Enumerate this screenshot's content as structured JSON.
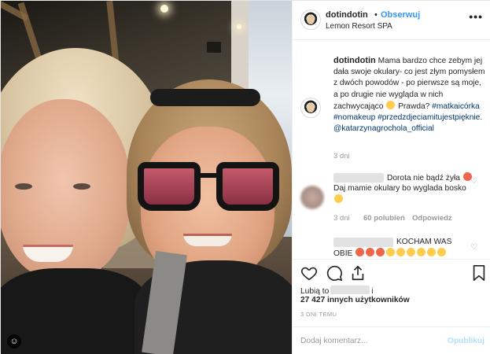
{
  "header": {
    "username": "dotindotin",
    "separator": "•",
    "follow_label": "Obserwuj",
    "location": "Lemon Resort SPA",
    "more_label": "•••"
  },
  "caption": {
    "username": "dotindotin",
    "text_1": "Mama bardzo chce zebym jej dała swoje okulary- co jest złym pomysłem z dwóch powodów - po pierwsze są moje, a po drugie nie wygląda w nich zachwycająco",
    "text_2": "Prawda?",
    "tags": [
      "#matkaicórka",
      "#nomakeup",
      "#przedzdjeciamitujestpięknie.",
      "@katarzynagrochola_official"
    ],
    "age": "3 dni"
  },
  "comments": [
    {
      "text_1": "Dorota nie bądź żyła",
      "text_2": "Daj mamie okulary bo wyglada bosko",
      "age": "3 dni",
      "likes": "60 polubień",
      "reply_label": "Odpowiedz"
    },
    {
      "text_1": "KOCHAM WAS",
      "text_2": "OBIE"
    }
  ],
  "actions": {
    "like_icon": "heart-icon",
    "comment_icon": "comment-icon",
    "share_icon": "share-icon",
    "save_icon": "bookmark-icon"
  },
  "likes": {
    "prefix": "Lubią to",
    "suffix": "i",
    "others": "27 427 innych użytkowników"
  },
  "date": "3 DNI TEMU",
  "add_comment": {
    "placeholder": "Dodaj komentarz...",
    "publish_label": "Opublikuj"
  },
  "colors": {
    "accent": "#3897f0",
    "hashtag": "#003569",
    "muted": "#999999",
    "publish_disabled": "#b2dffc"
  }
}
